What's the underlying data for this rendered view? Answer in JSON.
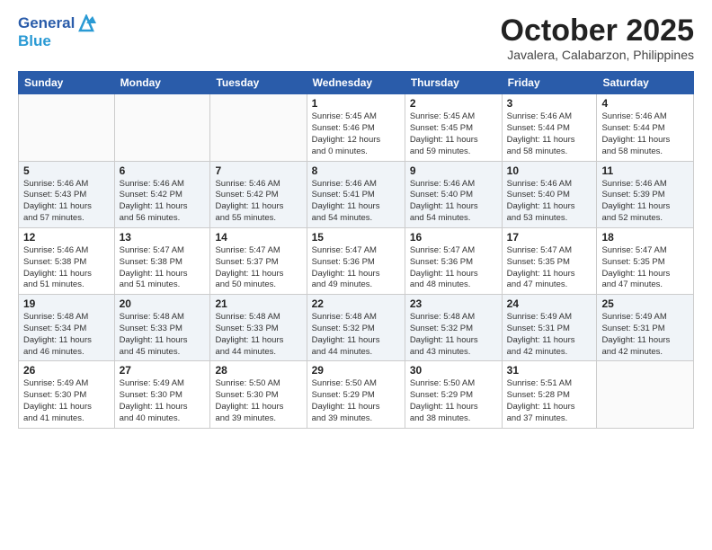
{
  "header": {
    "logo_line1": "General",
    "logo_line2": "Blue",
    "month": "October 2025",
    "location": "Javalera, Calabarzon, Philippines"
  },
  "weekdays": [
    "Sunday",
    "Monday",
    "Tuesday",
    "Wednesday",
    "Thursday",
    "Friday",
    "Saturday"
  ],
  "weeks": [
    [
      {
        "day": "",
        "info": ""
      },
      {
        "day": "",
        "info": ""
      },
      {
        "day": "",
        "info": ""
      },
      {
        "day": "1",
        "info": "Sunrise: 5:45 AM\nSunset: 5:46 PM\nDaylight: 12 hours\nand 0 minutes."
      },
      {
        "day": "2",
        "info": "Sunrise: 5:45 AM\nSunset: 5:45 PM\nDaylight: 11 hours\nand 59 minutes."
      },
      {
        "day": "3",
        "info": "Sunrise: 5:46 AM\nSunset: 5:44 PM\nDaylight: 11 hours\nand 58 minutes."
      },
      {
        "day": "4",
        "info": "Sunrise: 5:46 AM\nSunset: 5:44 PM\nDaylight: 11 hours\nand 58 minutes."
      }
    ],
    [
      {
        "day": "5",
        "info": "Sunrise: 5:46 AM\nSunset: 5:43 PM\nDaylight: 11 hours\nand 57 minutes."
      },
      {
        "day": "6",
        "info": "Sunrise: 5:46 AM\nSunset: 5:42 PM\nDaylight: 11 hours\nand 56 minutes."
      },
      {
        "day": "7",
        "info": "Sunrise: 5:46 AM\nSunset: 5:42 PM\nDaylight: 11 hours\nand 55 minutes."
      },
      {
        "day": "8",
        "info": "Sunrise: 5:46 AM\nSunset: 5:41 PM\nDaylight: 11 hours\nand 54 minutes."
      },
      {
        "day": "9",
        "info": "Sunrise: 5:46 AM\nSunset: 5:40 PM\nDaylight: 11 hours\nand 54 minutes."
      },
      {
        "day": "10",
        "info": "Sunrise: 5:46 AM\nSunset: 5:40 PM\nDaylight: 11 hours\nand 53 minutes."
      },
      {
        "day": "11",
        "info": "Sunrise: 5:46 AM\nSunset: 5:39 PM\nDaylight: 11 hours\nand 52 minutes."
      }
    ],
    [
      {
        "day": "12",
        "info": "Sunrise: 5:46 AM\nSunset: 5:38 PM\nDaylight: 11 hours\nand 51 minutes."
      },
      {
        "day": "13",
        "info": "Sunrise: 5:47 AM\nSunset: 5:38 PM\nDaylight: 11 hours\nand 51 minutes."
      },
      {
        "day": "14",
        "info": "Sunrise: 5:47 AM\nSunset: 5:37 PM\nDaylight: 11 hours\nand 50 minutes."
      },
      {
        "day": "15",
        "info": "Sunrise: 5:47 AM\nSunset: 5:36 PM\nDaylight: 11 hours\nand 49 minutes."
      },
      {
        "day": "16",
        "info": "Sunrise: 5:47 AM\nSunset: 5:36 PM\nDaylight: 11 hours\nand 48 minutes."
      },
      {
        "day": "17",
        "info": "Sunrise: 5:47 AM\nSunset: 5:35 PM\nDaylight: 11 hours\nand 47 minutes."
      },
      {
        "day": "18",
        "info": "Sunrise: 5:47 AM\nSunset: 5:35 PM\nDaylight: 11 hours\nand 47 minutes."
      }
    ],
    [
      {
        "day": "19",
        "info": "Sunrise: 5:48 AM\nSunset: 5:34 PM\nDaylight: 11 hours\nand 46 minutes."
      },
      {
        "day": "20",
        "info": "Sunrise: 5:48 AM\nSunset: 5:33 PM\nDaylight: 11 hours\nand 45 minutes."
      },
      {
        "day": "21",
        "info": "Sunrise: 5:48 AM\nSunset: 5:33 PM\nDaylight: 11 hours\nand 44 minutes."
      },
      {
        "day": "22",
        "info": "Sunrise: 5:48 AM\nSunset: 5:32 PM\nDaylight: 11 hours\nand 44 minutes."
      },
      {
        "day": "23",
        "info": "Sunrise: 5:48 AM\nSunset: 5:32 PM\nDaylight: 11 hours\nand 43 minutes."
      },
      {
        "day": "24",
        "info": "Sunrise: 5:49 AM\nSunset: 5:31 PM\nDaylight: 11 hours\nand 42 minutes."
      },
      {
        "day": "25",
        "info": "Sunrise: 5:49 AM\nSunset: 5:31 PM\nDaylight: 11 hours\nand 42 minutes."
      }
    ],
    [
      {
        "day": "26",
        "info": "Sunrise: 5:49 AM\nSunset: 5:30 PM\nDaylight: 11 hours\nand 41 minutes."
      },
      {
        "day": "27",
        "info": "Sunrise: 5:49 AM\nSunset: 5:30 PM\nDaylight: 11 hours\nand 40 minutes."
      },
      {
        "day": "28",
        "info": "Sunrise: 5:50 AM\nSunset: 5:30 PM\nDaylight: 11 hours\nand 39 minutes."
      },
      {
        "day": "29",
        "info": "Sunrise: 5:50 AM\nSunset: 5:29 PM\nDaylight: 11 hours\nand 39 minutes."
      },
      {
        "day": "30",
        "info": "Sunrise: 5:50 AM\nSunset: 5:29 PM\nDaylight: 11 hours\nand 38 minutes."
      },
      {
        "day": "31",
        "info": "Sunrise: 5:51 AM\nSunset: 5:28 PM\nDaylight: 11 hours\nand 37 minutes."
      },
      {
        "day": "",
        "info": ""
      }
    ]
  ]
}
